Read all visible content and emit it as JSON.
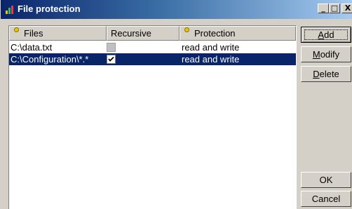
{
  "window": {
    "title": "File protection",
    "minimize_glyph": "_",
    "maximize_glyph": "□",
    "close_glyph": "X"
  },
  "list": {
    "columns": [
      {
        "label": "Files",
        "marker": true
      },
      {
        "label": "Recursive",
        "marker": false
      },
      {
        "label": "Protection",
        "marker": true
      }
    ],
    "rows": [
      {
        "file": "C:\\data.txt",
        "recursive": false,
        "recursive_enabled": false,
        "protection": "read and write",
        "selected": false
      },
      {
        "file": "C:\\Configuration\\*.*",
        "recursive": true,
        "recursive_enabled": true,
        "protection": "read and write",
        "selected": true
      }
    ]
  },
  "buttons": {
    "add": {
      "label_rest": "dd",
      "accel": "A"
    },
    "modify": {
      "label_rest": "odify",
      "accel": "M"
    },
    "delete": {
      "label_rest": "elete",
      "accel": "D"
    },
    "ok": "OK",
    "cancel": "Cancel"
  },
  "colors": {
    "selection": "#0a246a",
    "titlebar_start": "#0a246a",
    "titlebar_end": "#a6caf0",
    "face": "#d4d0c8",
    "marker": "#e8c800"
  }
}
